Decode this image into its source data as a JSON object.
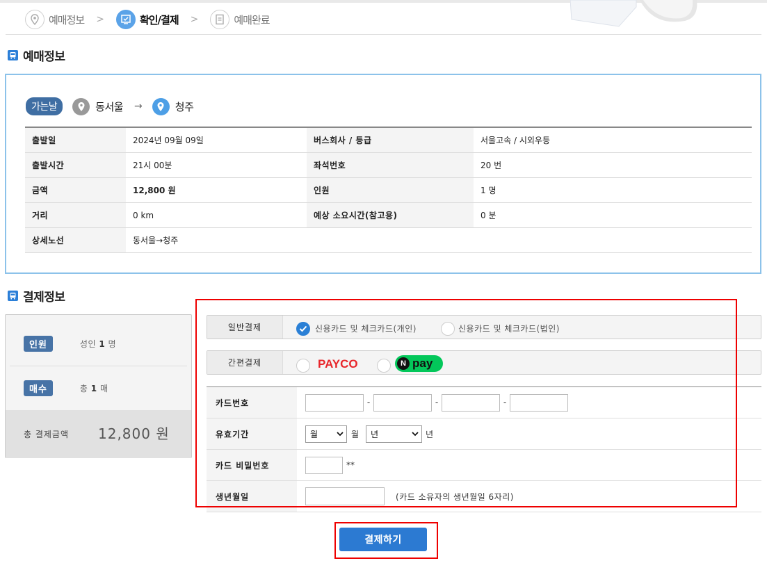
{
  "steps": [
    {
      "label": "예매정보",
      "state": "inactive",
      "icon": "location-pin-icon"
    },
    {
      "label": "확인/결제",
      "state": "active",
      "icon": "check-screen-icon"
    },
    {
      "label": "예매완료",
      "state": "inactive",
      "icon": "document-icon"
    }
  ],
  "step_separator": ">",
  "reservation": {
    "title": "예매정보",
    "direction_badge": "가는날",
    "from": "동서울",
    "arrow": "→",
    "to": "청주",
    "rows": [
      [
        "출발일",
        "2024년 09월 09일",
        "버스회사 / 등급",
        "서울고속 / 시외우등"
      ],
      [
        "출발시간",
        "21시 00분",
        "좌석번호",
        "20 번"
      ],
      [
        "금액",
        "12,800 원",
        "인원",
        "1 명"
      ],
      [
        "거리",
        "0 km",
        "예상 소요시간(참고용)",
        "0 분"
      ],
      [
        "상세노선",
        "동서울→청주",
        "",
        ""
      ]
    ]
  },
  "payment": {
    "title": "결제정보",
    "summary": {
      "people_label": "인원",
      "people_prefix": "성인 ",
      "people_count": "1",
      "people_unit": " 명",
      "tickets_label": "매수",
      "tickets_prefix": "총 ",
      "tickets_count": "1",
      "tickets_unit": " 매",
      "total_label": "총 결제금액",
      "total_value": "12,800 원"
    },
    "general_label": "일반결제",
    "general_options": [
      "신용카드 및 체크카드(개인)",
      "신용카드 및 체크카드(법인)"
    ],
    "general_selected": 0,
    "easy_label": "간편결제",
    "easy_options": [
      "PAYCO",
      "pay"
    ],
    "card_number_label": "카드번호",
    "card_dash": "-",
    "expiry_label": "유효기간",
    "month_select": "월",
    "month_unit": "월",
    "year_select": "년",
    "year_unit": "년",
    "password_label": "카드 비밀번호",
    "password_suffix": "**",
    "birth_label": "생년월일",
    "birth_hint": "(카드 소유자의 생년월일 6자리)",
    "submit_label": "결제하기"
  },
  "colors": {
    "accent": "#2c7ad2",
    "badge": "#4773a6",
    "highlight": "#e00000",
    "npay": "#03c75a",
    "payco": "#e8262b"
  }
}
